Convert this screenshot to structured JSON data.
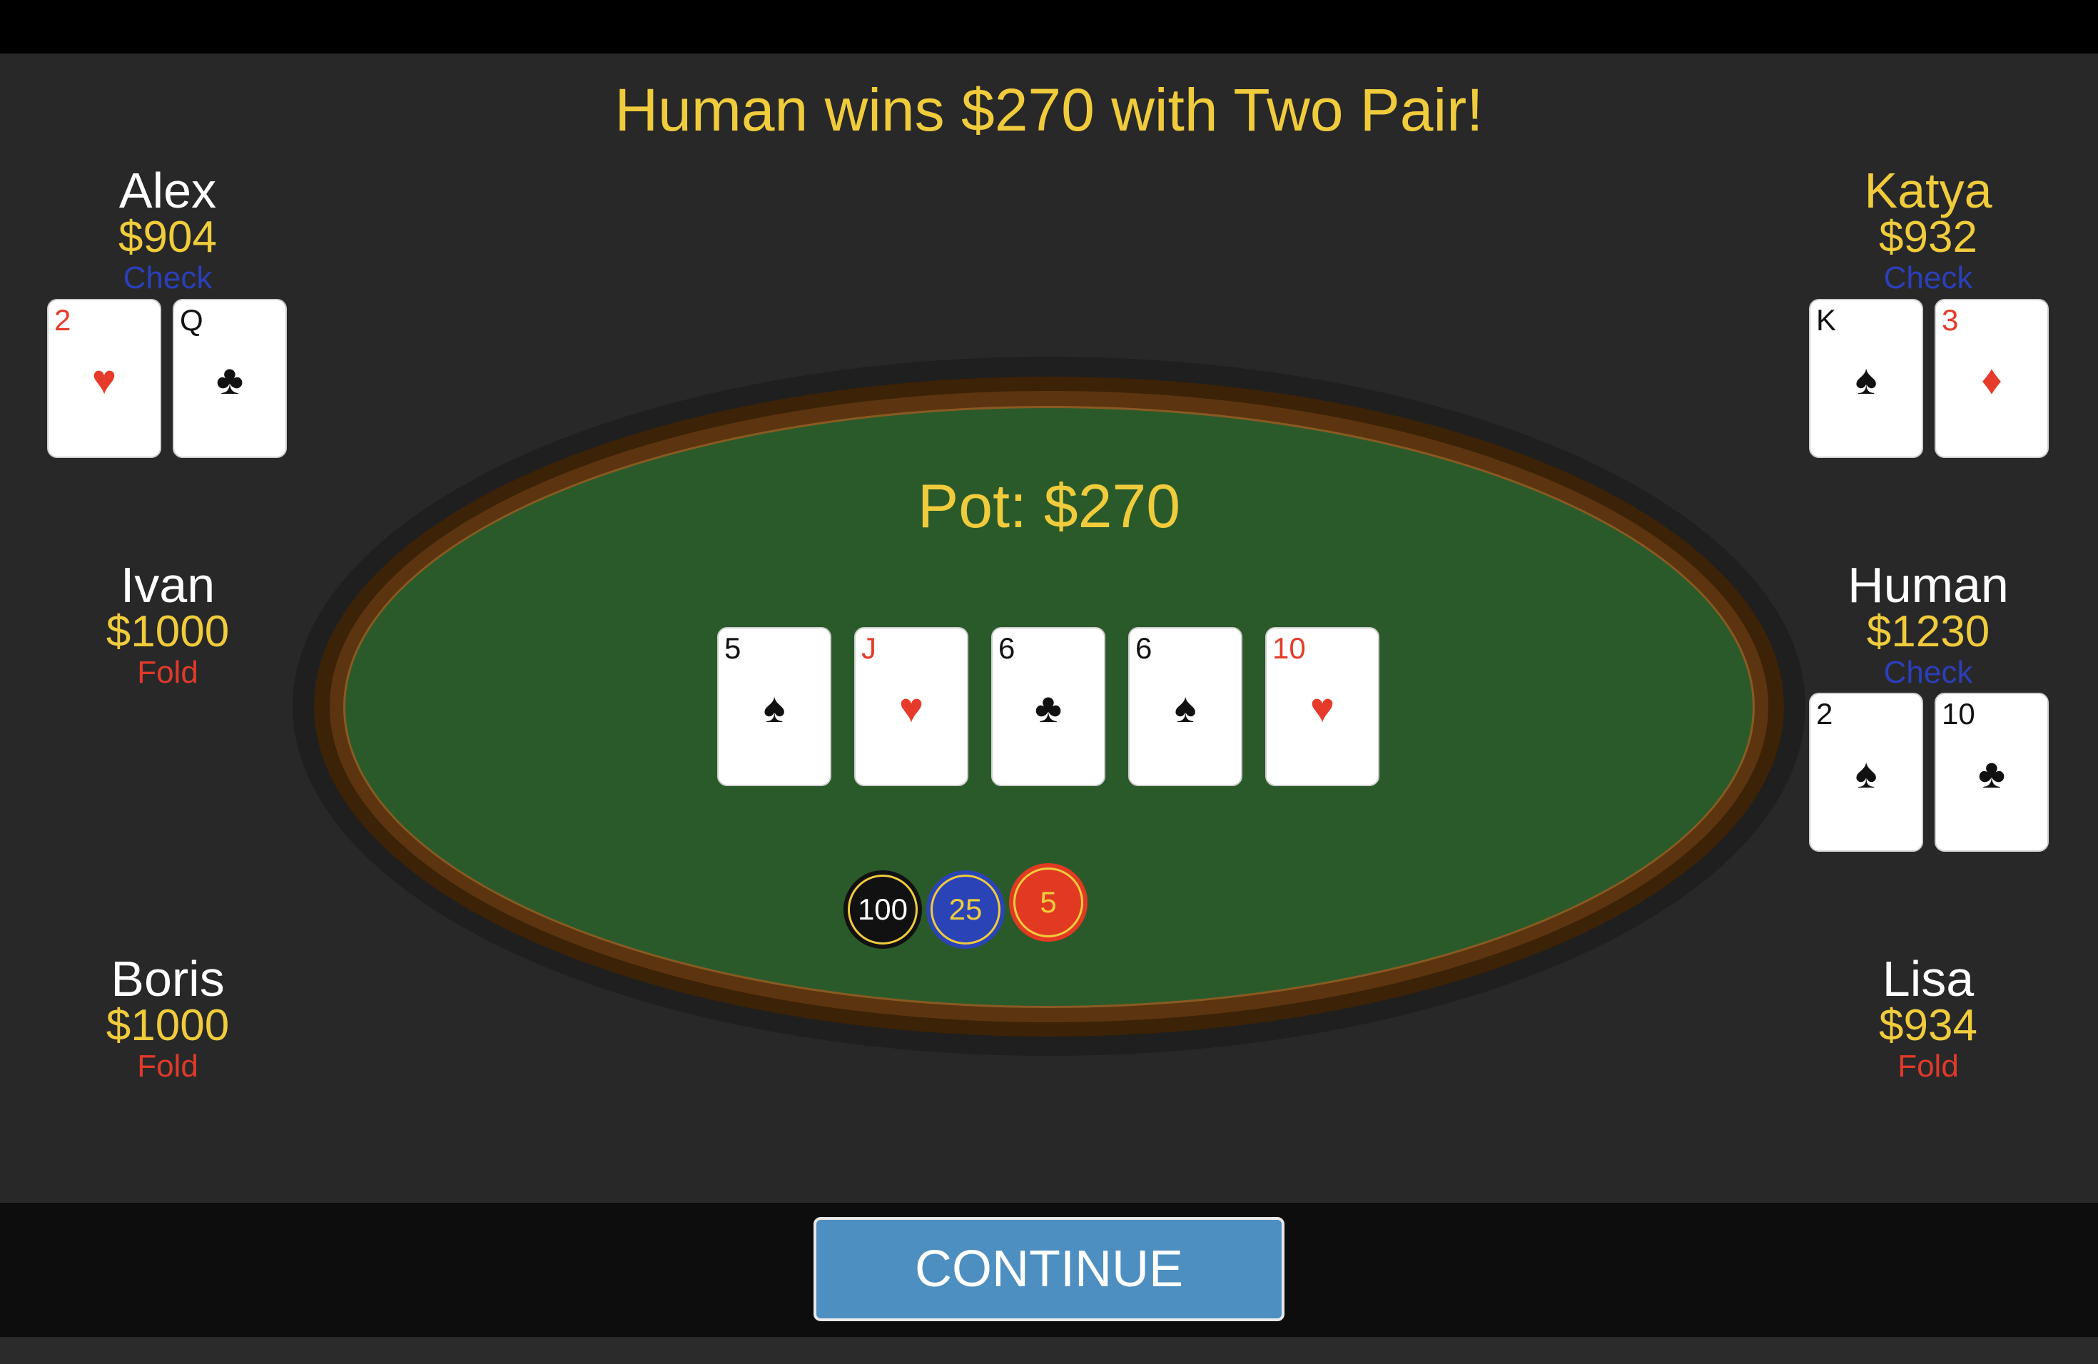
{
  "banner": "Human wins $270 with Two Pair!",
  "pot_label": "Pot: $270",
  "players": {
    "alex": {
      "name": "Alex",
      "chips": "$904",
      "action": "Check",
      "cards": [
        {
          "rank": "2",
          "suit": "♥",
          "color": "red"
        },
        {
          "rank": "Q",
          "suit": "♣",
          "color": "black"
        }
      ]
    },
    "katya": {
      "name": "Katya",
      "chips": "$932",
      "action": "Check",
      "cards": [
        {
          "rank": "K",
          "suit": "♠",
          "color": "black"
        },
        {
          "rank": "3",
          "suit": "♦",
          "color": "red"
        }
      ]
    },
    "ivan": {
      "name": "Ivan",
      "chips": "$1000",
      "action": "Fold"
    },
    "human": {
      "name": "Human",
      "chips": "$1230",
      "action": "Check",
      "cards": [
        {
          "rank": "2",
          "suit": "♠",
          "color": "black"
        },
        {
          "rank": "10",
          "suit": "♣",
          "color": "black"
        }
      ]
    },
    "boris": {
      "name": "Boris",
      "chips": "$1000",
      "action": "Fold"
    },
    "lisa": {
      "name": "Lisa",
      "chips": "$934",
      "action": "Fold"
    }
  },
  "board": [
    {
      "rank": "5",
      "suit": "♠",
      "color": "black"
    },
    {
      "rank": "J",
      "suit": "♥",
      "color": "red"
    },
    {
      "rank": "6",
      "suit": "♣",
      "color": "black"
    },
    {
      "rank": "6",
      "suit": "♠",
      "color": "black"
    },
    {
      "rank": "10",
      "suit": "♥",
      "color": "red"
    }
  ],
  "chips": [
    {
      "value": "100",
      "color": "#111111"
    },
    {
      "value": "25",
      "color": "#2a44b8"
    },
    {
      "value": "5",
      "color": "#e23a22"
    }
  ],
  "continue_label": "CONTINUE"
}
